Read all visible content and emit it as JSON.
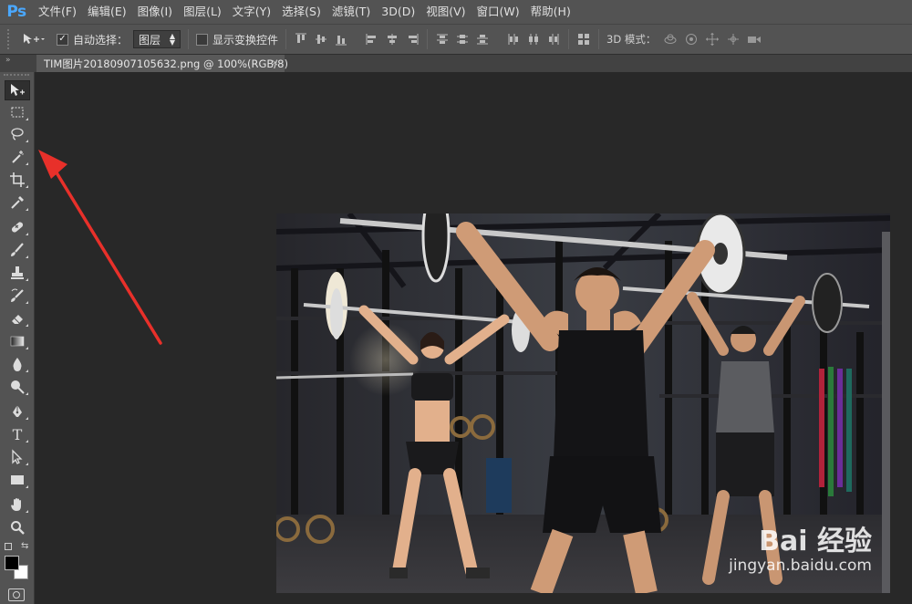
{
  "app": {
    "logo": "Ps",
    "accent_color": "#31a8ff"
  },
  "menu": [
    "文件(F)",
    "编辑(E)",
    "图像(I)",
    "图层(L)",
    "文字(Y)",
    "选择(S)",
    "滤镜(T)",
    "3D(D)",
    "视图(V)",
    "窗口(W)",
    "帮助(H)"
  ],
  "options": {
    "auto_select_label": "自动选择：",
    "auto_select_checked": true,
    "target_select": "图层",
    "show_transform_label": "显示变换控件",
    "show_transform_checked": false,
    "mode_3d_label": "3D 模式："
  },
  "document": {
    "tab_title": "TIM图片20180907105632.png @ 100%(RGB/8)",
    "close_glyph": "×"
  },
  "tools": [
    {
      "name": "move-tool-icon",
      "active": true
    },
    {
      "name": "rectangular-marquee-tool-icon"
    },
    {
      "name": "lasso-tool-icon"
    },
    {
      "name": "magic-wand-tool-icon"
    },
    {
      "name": "crop-tool-icon"
    },
    {
      "name": "eyedropper-tool-icon"
    },
    {
      "name": "healing-brush-tool-icon"
    },
    {
      "name": "brush-tool-icon"
    },
    {
      "name": "clone-stamp-tool-icon"
    },
    {
      "name": "history-brush-tool-icon"
    },
    {
      "name": "eraser-tool-icon"
    },
    {
      "name": "gradient-tool-icon"
    },
    {
      "name": "blur-tool-icon"
    },
    {
      "name": "dodge-tool-icon"
    },
    {
      "name": "pen-tool-icon"
    },
    {
      "name": "type-tool-icon",
      "glyph": "T"
    },
    {
      "name": "path-selection-tool-icon"
    },
    {
      "name": "rectangle-tool-icon"
    },
    {
      "name": "hand-tool-icon"
    },
    {
      "name": "zoom-tool-icon"
    }
  ],
  "swatches": {
    "foreground": "#000000",
    "background": "#ffffff"
  },
  "annotation": {
    "arrow_color": "#e8302a"
  },
  "watermark": {
    "brand": "Bai 经验",
    "url": "jingyan.baidu.com"
  }
}
